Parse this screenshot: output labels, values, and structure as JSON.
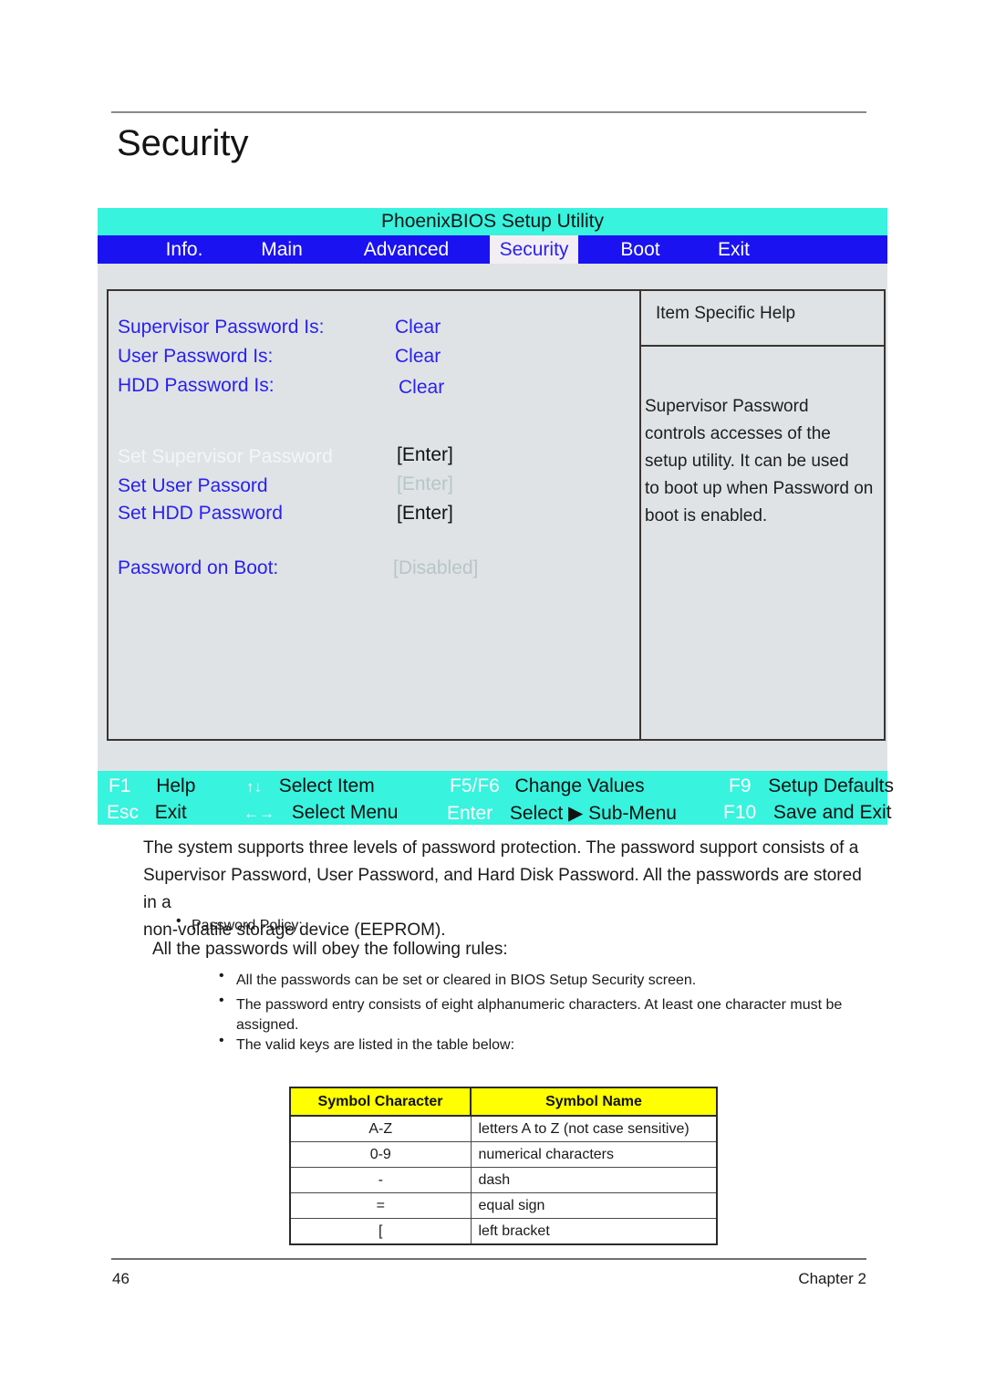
{
  "page": {
    "title": "Security",
    "footer_page_number": "46",
    "footer_chapter": "Chapter 2"
  },
  "bios": {
    "title": "PhoenixBIOS Setup Utility",
    "colors": {
      "titlebar": "#38f3dd",
      "tabbar": "#1a12f0",
      "active_tab_bg": "#f2eef4",
      "active_tab_text": "#2a1ff0",
      "panel_bg": "#dfe3e5",
      "label_blue": "#2a1ff0",
      "fnbar": "#38f3dd"
    },
    "tabs": [
      {
        "label": "Info.",
        "active": false
      },
      {
        "label": "Main",
        "active": false
      },
      {
        "label": "Advanced",
        "active": false
      },
      {
        "label": "Security",
        "active": true
      },
      {
        "label": "Boot",
        "active": false
      },
      {
        "label": "Exit",
        "active": false
      }
    ],
    "settings": [
      {
        "label": "Supervisor Password Is:",
        "value": "Clear",
        "value_style": "blue",
        "label_style": "blue"
      },
      {
        "label": "User Password Is:",
        "value": "Clear",
        "value_style": "blue",
        "label_style": "blue"
      },
      {
        "label": "HDD Password Is:",
        "value": "Clear",
        "value_style": "blue",
        "label_style": "blue"
      },
      {
        "label": "Set Supervisor Password",
        "value": "[Enter]",
        "value_style": "black",
        "label_style": "dim"
      },
      {
        "label": "Set User Passord",
        "value": "[Enter]",
        "value_style": "grey",
        "label_style": "blue"
      },
      {
        "label": "Set HDD Password",
        "value": "[Enter]",
        "value_style": "black",
        "label_style": "blue"
      },
      {
        "label": "Password on Boot:",
        "value": "[Disabled]",
        "value_style": "grey",
        "label_style": "blue"
      }
    ],
    "help": {
      "title": "Item Specific Help",
      "lines": [
        "Supervisor Password",
        "controls accesses of the",
        " setup utility.  It can be used",
        "to boot up when Password on",
        "boot is enabled."
      ]
    },
    "function_keys": [
      {
        "key": "F1",
        "action": "Help"
      },
      {
        "key": "↑↓",
        "action": "Select Item"
      },
      {
        "key": "F5/F6",
        "action": "Change Values"
      },
      {
        "key": "F9",
        "action": "Setup Defaults"
      },
      {
        "key": "Esc",
        "action": "Exit"
      },
      {
        "key": "←→",
        "action": "Select Menu"
      },
      {
        "key": "Enter",
        "action": "Select  ▶ Sub-Menu"
      },
      {
        "key": "F10",
        "action": "Save and Exit"
      }
    ]
  },
  "body": {
    "intro_lines": [
      "The system supports three levels of password protection. The password support consists of a",
      "Supervisor Password, User Password, and Hard Disk Password. All the passwords are stored in a",
      "non-volatile storage device (EEPROM)."
    ],
    "policy_bullet": "Password Policy:",
    "rules_lead": "All the passwords will obey the following rules:",
    "rules": [
      [
        "All the passwords can be set or cleared in BIOS Setup Security screen."
      ],
      [
        "The password entry consists of eight alphanumeric characters. At least one character must be",
        "assigned."
      ],
      [
        "The valid keys are listed in the table below:"
      ]
    ]
  },
  "symbol_table": {
    "headers": [
      "Symbol Character",
      "Symbol Name"
    ],
    "rows": [
      [
        "A-Z",
        "letters A to Z (not case sensitive)"
      ],
      [
        "0-9",
        "numerical characters"
      ],
      [
        "-",
        "dash"
      ],
      [
        "=",
        "equal sign"
      ],
      [
        "[",
        "left bracket"
      ]
    ]
  }
}
